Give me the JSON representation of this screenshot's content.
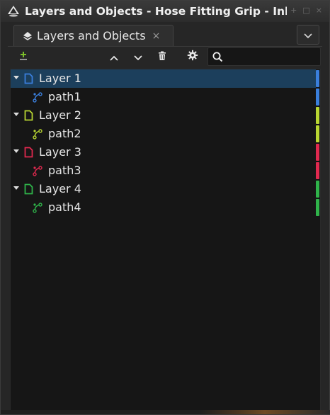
{
  "window": {
    "title": "Layers and Objects - Hose Fitting Grip - Inksc",
    "controls": [
      "+",
      "□",
      "×"
    ]
  },
  "tab": {
    "label": "Layers and Objects",
    "close": "×",
    "icon": "layers-icon"
  },
  "toolbar": {
    "buttons": [
      "add-layer-icon",
      "move-up-icon",
      "move-down-icon",
      "delete-icon",
      "settings-icon"
    ],
    "search_value": "",
    "search_icon": "search-icon"
  },
  "tree": {
    "layers": [
      {
        "label": "Layer 1",
        "color": "#3a7fdc",
        "expanded": true,
        "selected": true,
        "children": [
          {
            "label": "path1"
          }
        ]
      },
      {
        "label": "Layer 2",
        "color": "#b9d632",
        "expanded": true,
        "selected": false,
        "children": [
          {
            "label": "path2"
          }
        ]
      },
      {
        "label": "Layer 3",
        "color": "#e0294f",
        "expanded": true,
        "selected": false,
        "children": [
          {
            "label": "path3"
          }
        ]
      },
      {
        "label": "Layer 4",
        "color": "#2fb34a",
        "expanded": true,
        "selected": false,
        "children": [
          {
            "label": "path4"
          }
        ]
      }
    ]
  },
  "colors": {
    "selection": "#1c3f5c",
    "tree_bg": "#161616",
    "panel_bg": "#262626"
  }
}
